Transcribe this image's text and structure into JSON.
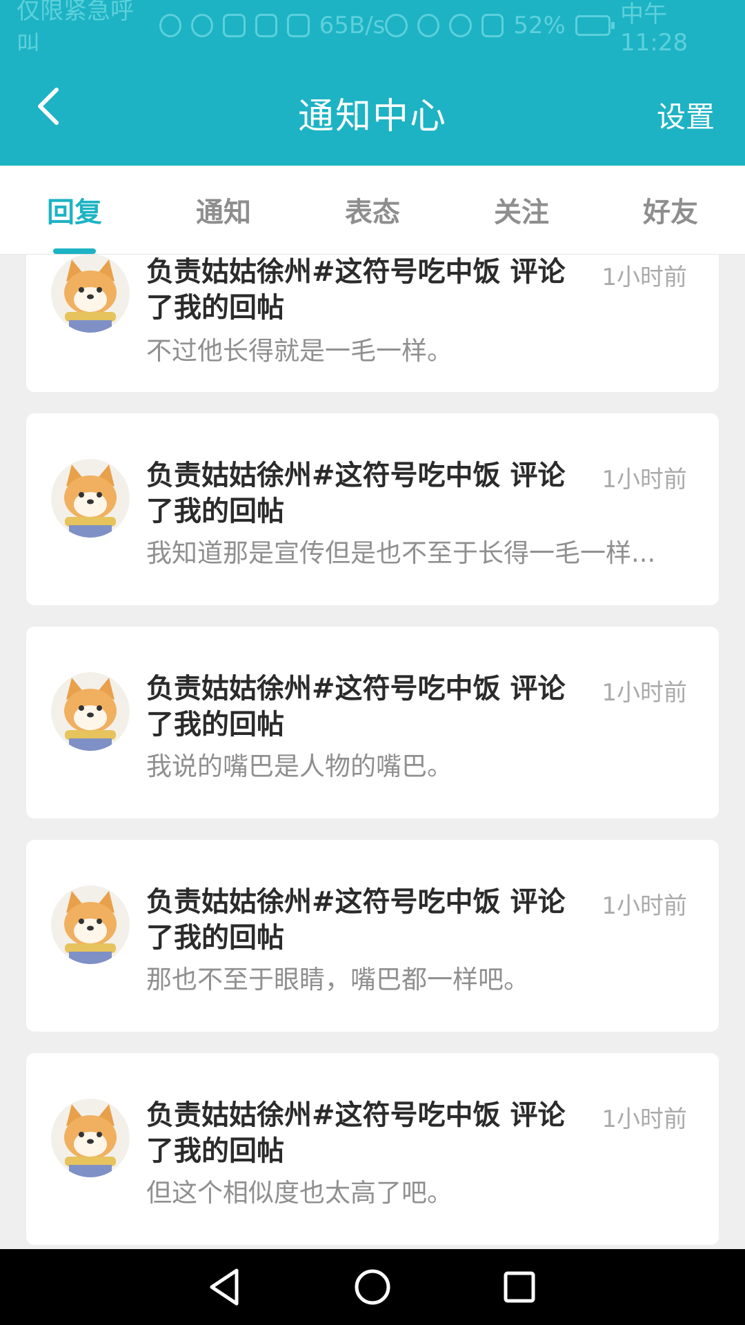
{
  "status_bar": {
    "left_text": "仅限紧急呼叫",
    "speed": "65B/s",
    "battery": "52%",
    "time": "中午11:28"
  },
  "header": {
    "title": "通知中心",
    "settings_label": "设置",
    "back_icon": "chevron-left-icon",
    "bg_color": "#1db3c4"
  },
  "tabs": [
    {
      "label": "回复",
      "active": true
    },
    {
      "label": "通知",
      "active": false
    },
    {
      "label": "表态",
      "active": false
    },
    {
      "label": "关注",
      "active": false
    },
    {
      "label": "好友",
      "active": false
    }
  ],
  "notifications": [
    {
      "title": "负责姑姑徐州#这符号吃中饭 评论了我的回帖",
      "time": "1小时前",
      "snippet": "不过他长得就是一毛一样。"
    },
    {
      "title": "负责姑姑徐州#这符号吃中饭 评论了我的回帖",
      "time": "1小时前",
      "snippet": "我知道那是宣传但是也不至于长得一毛一样..."
    },
    {
      "title": "负责姑姑徐州#这符号吃中饭 评论了我的回帖",
      "time": "1小时前",
      "snippet": "我说的嘴巴是人物的嘴巴。"
    },
    {
      "title": "负责姑姑徐州#这符号吃中饭 评论了我的回帖",
      "time": "1小时前",
      "snippet": "那也不至于眼睛，嘴巴都一样吧。"
    },
    {
      "title": "负责姑姑徐州#这符号吃中饭 评论了我的回帖",
      "time": "1小时前",
      "snippet": "但这个相似度也太高了吧。"
    }
  ],
  "nav": {
    "back_icon": "triangle-back-icon",
    "home_icon": "circle-home-icon",
    "recent_icon": "square-recent-icon"
  }
}
